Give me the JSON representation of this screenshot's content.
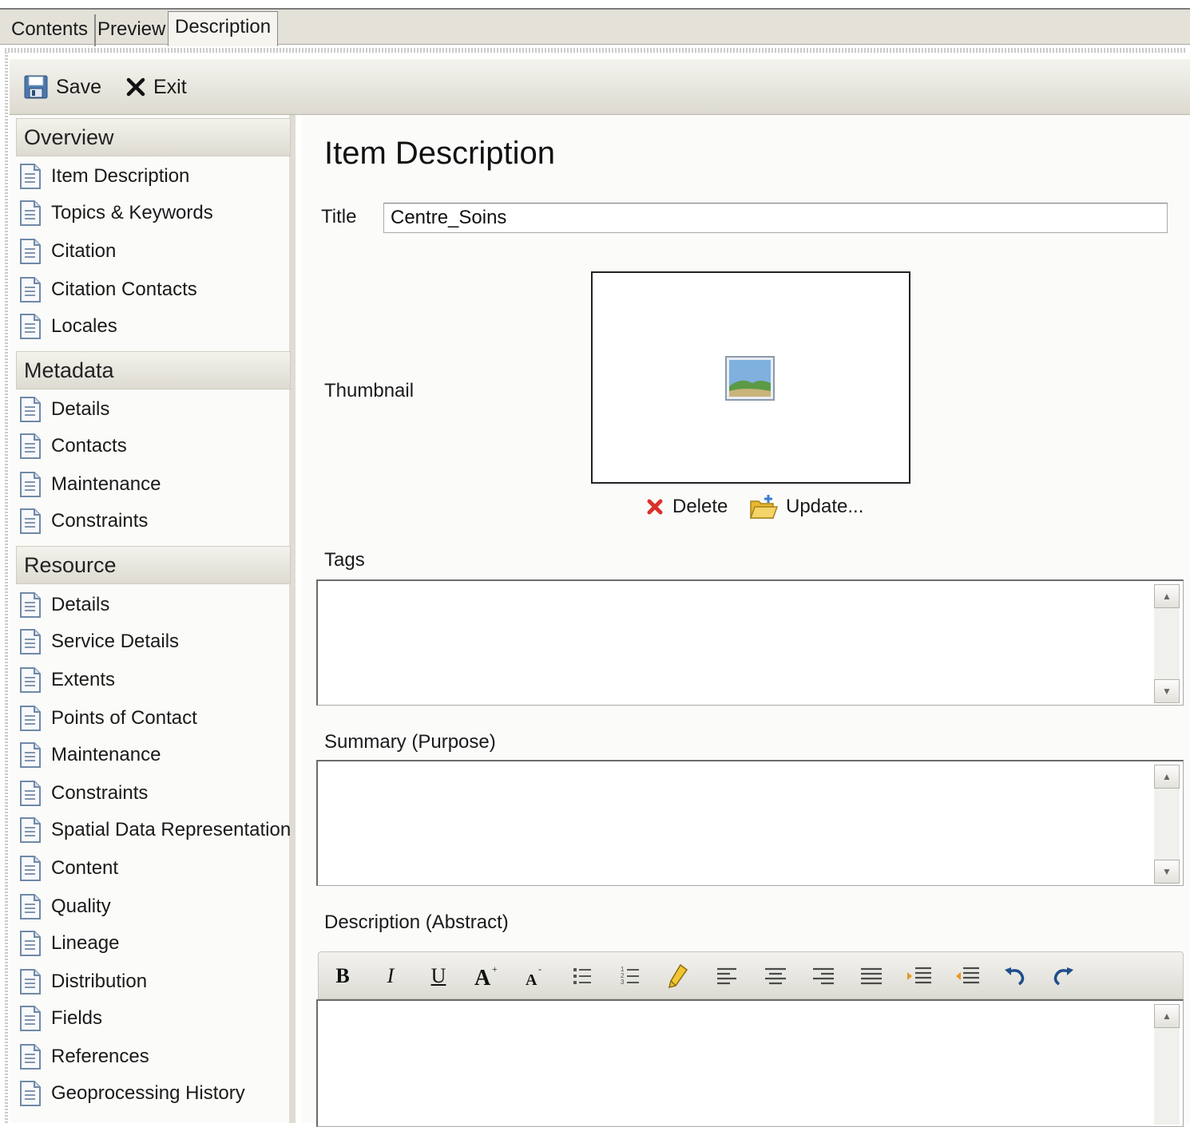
{
  "tabs": [
    {
      "label": "Contents",
      "active": false
    },
    {
      "label": "Preview",
      "active": false
    },
    {
      "label": "Description",
      "active": true
    }
  ],
  "toolbar": {
    "save_label": "Save",
    "exit_label": "Exit"
  },
  "sidebar": {
    "sections": [
      {
        "title": "Overview",
        "items": [
          "Item Description",
          "Topics & Keywords",
          "Citation",
          "Citation Contacts",
          "Locales"
        ]
      },
      {
        "title": "Metadata",
        "items": [
          "Details",
          "Contacts",
          "Maintenance",
          "Constraints"
        ]
      },
      {
        "title": "Resource",
        "items": [
          "Details",
          "Service Details",
          "Extents",
          "Points of Contact",
          "Maintenance",
          "Constraints",
          "Spatial Data Representation",
          "Content",
          "Quality",
          "Lineage",
          "Distribution",
          "Fields",
          "References",
          "Geoprocessing History"
        ]
      }
    ]
  },
  "main": {
    "page_title": "Item Description",
    "title_label": "Title",
    "title_value": "Centre_Soins",
    "thumbnail_label": "Thumbnail",
    "delete_label": "Delete",
    "update_label": "Update...",
    "tags_label": "Tags",
    "tags_value": "",
    "summary_label": "Summary (Purpose)",
    "summary_value": "",
    "description_label": "Description (Abstract)",
    "description_value": ""
  },
  "rte": {
    "bold": "B",
    "italic": "I",
    "underline": "U"
  },
  "colors": {
    "accent_delete": "#d9322b",
    "folder_yellow": "#e8b72f",
    "save_blue": "#3a6ea5"
  }
}
